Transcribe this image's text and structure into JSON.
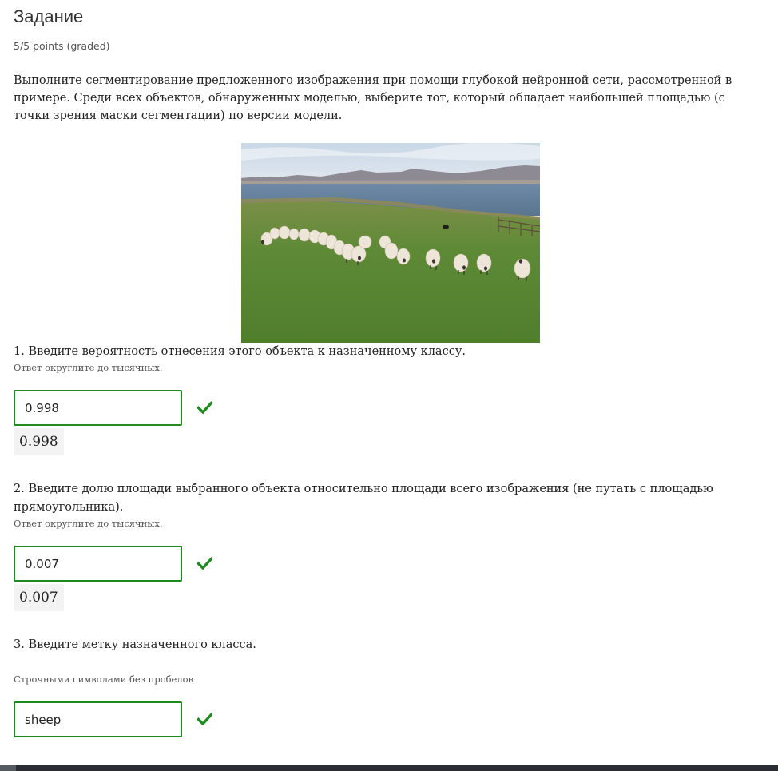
{
  "task": {
    "title": "Задание",
    "points": "5/5 points (graded)",
    "description": "Выполните сегментирование предложенного изображения при помощи глубокой нейронной сети, рассмотренной в примере. Среди всех объектов, обнаруженных моделью, выберите тот, который обладает наибольшей площадью (с точки зрения маски сегментации) по версии модели."
  },
  "questions": [
    {
      "text": "1. Введите вероятность отнесения этого объекта к назначенному классу.",
      "hint": "Ответ округлите до тысячных.",
      "value": "0.998",
      "echo": "0.998",
      "status": "correct"
    },
    {
      "text": "2. Введите долю площади выбранного объекта относительно площади всего изображения (не путать с площадью прямоугольника).",
      "hint": "Ответ округлите до тысячных.",
      "value": "0.007",
      "echo": "0.007",
      "status": "correct"
    },
    {
      "text": "3. Введите метку назначенного класса.",
      "hint": "Строчными символами без пробелов",
      "value": "sheep",
      "status": "correct"
    }
  ],
  "colors": {
    "correct": "#1f8a1f",
    "echo_bg": "#f3f3f3"
  },
  "icons": {
    "status": "checkmark-icon"
  }
}
